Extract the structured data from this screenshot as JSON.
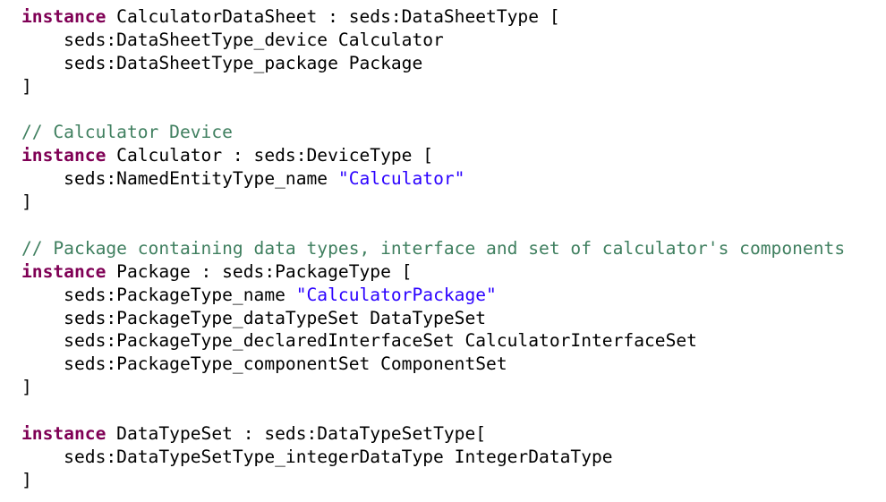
{
  "colors": {
    "background": "#ffffff",
    "text": "#000000",
    "keyword": "#7f0055",
    "comment": "#3f7f5f",
    "string": "#2a00ff"
  },
  "lines": [
    [
      {
        "type": "kw",
        "text": "instance"
      },
      {
        "type": "plain",
        "text": " CalculatorDataSheet : seds:DataSheetType ["
      }
    ],
    [
      {
        "type": "plain",
        "text": "    seds:DataSheetType_device Calculator"
      }
    ],
    [
      {
        "type": "plain",
        "text": "    seds:DataSheetType_package Package"
      }
    ],
    [
      {
        "type": "plain",
        "text": "]"
      }
    ],
    [],
    [
      {
        "type": "cm",
        "text": "// Calculator Device"
      }
    ],
    [
      {
        "type": "kw",
        "text": "instance"
      },
      {
        "type": "plain",
        "text": " Calculator : seds:DeviceType ["
      }
    ],
    [
      {
        "type": "plain",
        "text": "    seds:NamedEntityType_name "
      },
      {
        "type": "str",
        "text": "\"Calculator\""
      }
    ],
    [
      {
        "type": "plain",
        "text": "]"
      }
    ],
    [],
    [
      {
        "type": "cm",
        "text": "// Package containing data types, interface and set of calculator's components"
      }
    ],
    [
      {
        "type": "kw",
        "text": "instance"
      },
      {
        "type": "plain",
        "text": " Package : seds:PackageType ["
      }
    ],
    [
      {
        "type": "plain",
        "text": "    seds:PackageType_name "
      },
      {
        "type": "str",
        "text": "\"CalculatorPackage\""
      }
    ],
    [
      {
        "type": "plain",
        "text": "    seds:PackageType_dataTypeSet DataTypeSet"
      }
    ],
    [
      {
        "type": "plain",
        "text": "    seds:PackageType_declaredInterfaceSet CalculatorInterfaceSet"
      }
    ],
    [
      {
        "type": "plain",
        "text": "    seds:PackageType_componentSet ComponentSet"
      }
    ],
    [
      {
        "type": "plain",
        "text": "]"
      }
    ],
    [],
    [
      {
        "type": "kw",
        "text": "instance"
      },
      {
        "type": "plain",
        "text": " DataTypeSet : seds:DataTypeSetType["
      }
    ],
    [
      {
        "type": "plain",
        "text": "    seds:DataTypeSetType_integerDataType IntegerDataType"
      }
    ],
    [
      {
        "type": "plain",
        "text": "]"
      }
    ]
  ]
}
